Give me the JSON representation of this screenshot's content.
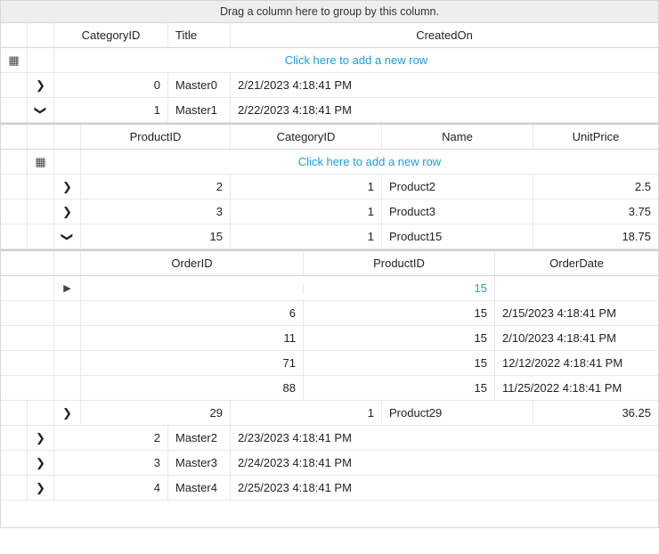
{
  "groupPanel": "Drag a column here to group by this column.",
  "addRowText": "Click here to add a new row",
  "master": {
    "columns": {
      "id": "CategoryID",
      "title": "Title",
      "created": "CreatedOn"
    },
    "rows": [
      {
        "id": "0",
        "title": "Master0",
        "created": "2/21/2023 4:18:41 PM"
      },
      {
        "id": "1",
        "title": "Master1",
        "created": "2/22/2023 4:18:41 PM"
      },
      {
        "id": "2",
        "title": "Master2",
        "created": "2/23/2023 4:18:41 PM"
      },
      {
        "id": "3",
        "title": "Master3",
        "created": "2/24/2023 4:18:41 PM"
      },
      {
        "id": "4",
        "title": "Master4",
        "created": "2/25/2023 4:18:41 PM"
      }
    ]
  },
  "level1": {
    "columns": {
      "pid": "ProductID",
      "cat": "CategoryID",
      "name": "Name",
      "price": "UnitPrice"
    },
    "rows": [
      {
        "pid": "2",
        "cat": "1",
        "name": "Product2",
        "price": "2.5"
      },
      {
        "pid": "3",
        "cat": "1",
        "name": "Product3",
        "price": "3.75"
      },
      {
        "pid": "15",
        "cat": "1",
        "name": "Product15",
        "price": "18.75"
      },
      {
        "pid": "29",
        "cat": "1",
        "name": "Product29",
        "price": "36.25"
      }
    ]
  },
  "level2": {
    "columns": {
      "oid": "OrderID",
      "pid": "ProductID",
      "date": "OrderDate"
    },
    "newRowPid": "15",
    "rows": [
      {
        "oid": "6",
        "pid": "15",
        "date": "2/15/2023 4:18:41 PM"
      },
      {
        "oid": "11",
        "pid": "15",
        "date": "2/10/2023 4:18:41 PM"
      },
      {
        "oid": "71",
        "pid": "15",
        "date": "12/12/2022 4:18:41 PM"
      },
      {
        "oid": "88",
        "pid": "15",
        "date": "11/25/2022 4:18:41 PM"
      }
    ]
  }
}
